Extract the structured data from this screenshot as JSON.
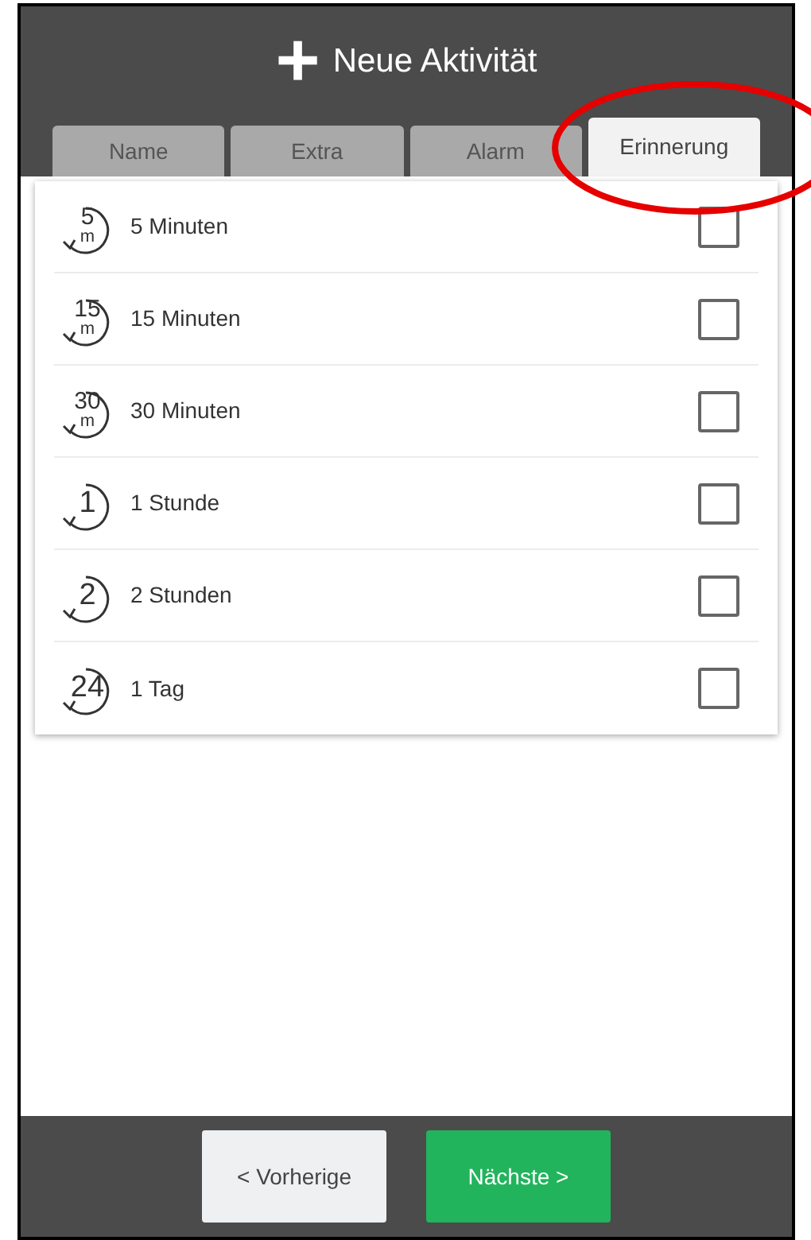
{
  "header": {
    "icon": "+",
    "title": "Neue Aktivität"
  },
  "tabs": [
    {
      "label": "Name",
      "selected": false
    },
    {
      "label": "Extra",
      "selected": false
    },
    {
      "label": "Alarm",
      "selected": false
    },
    {
      "label": "Erinnerung",
      "selected": true
    }
  ],
  "reminders": [
    {
      "icon_number": "5",
      "icon_unit": "m",
      "label": "5 Minuten",
      "checked": false
    },
    {
      "icon_number": "15",
      "icon_unit": "m",
      "label": "15 Minuten",
      "checked": false
    },
    {
      "icon_number": "30",
      "icon_unit": "m",
      "label": "30 Minuten",
      "checked": false
    },
    {
      "icon_number": "1",
      "label": "1 Stunde",
      "checked": false
    },
    {
      "icon_number": "2",
      "label": "2 Stunden",
      "checked": false
    },
    {
      "icon_number": "24",
      "label": "1 Tag",
      "checked": false
    }
  ],
  "buttons": [
    {
      "label": "< Vorherige",
      "kind": "secondary"
    },
    {
      "label": "Nächste >",
      "kind": "primary"
    }
  ]
}
